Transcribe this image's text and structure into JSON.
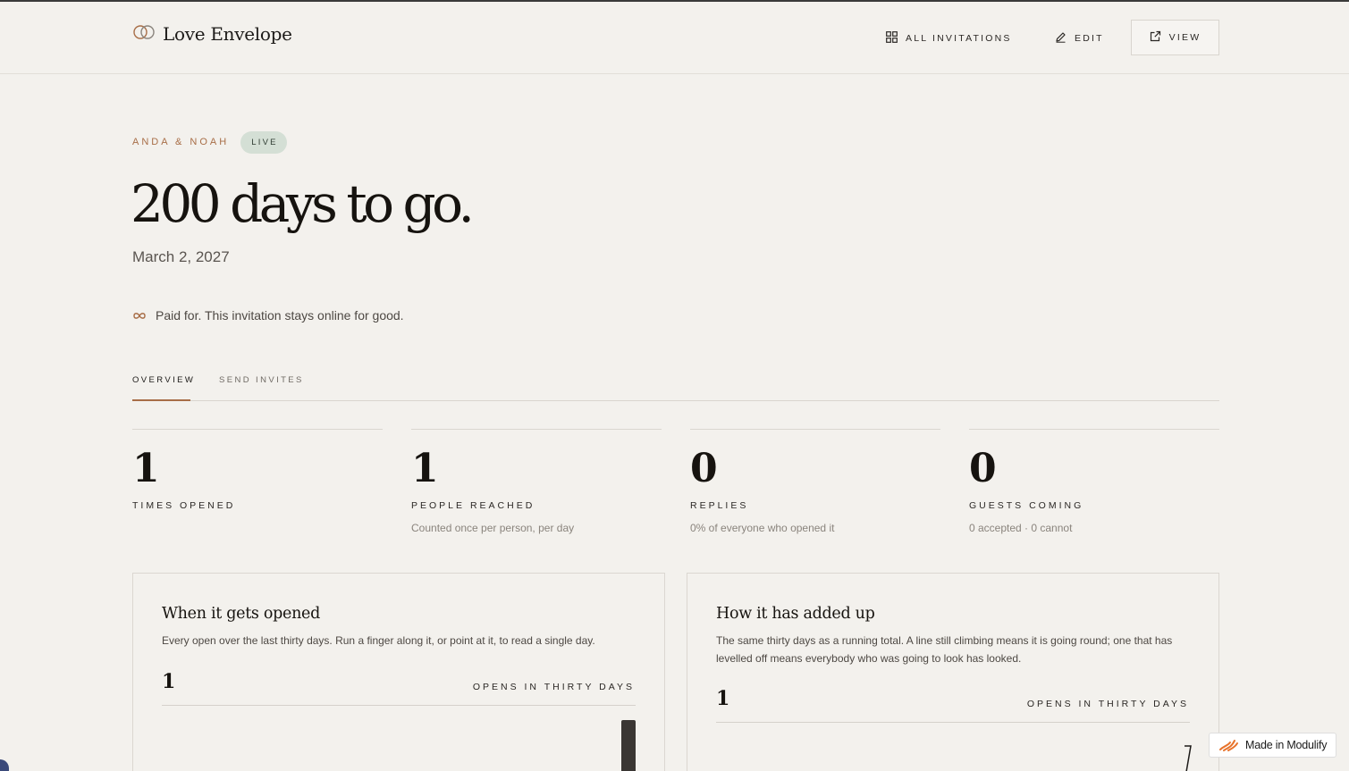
{
  "header": {
    "logo_text": "Love Envelope",
    "nav": {
      "all_invitations": "ALL INVITATIONS",
      "edit": "EDIT",
      "view": "VIEW"
    }
  },
  "hero": {
    "couple": "ANDA & NOAH",
    "status_badge": "LIVE",
    "countdown": "200 days to go.",
    "date": "March 2, 2027",
    "paid_note": "Paid for. This invitation stays online for good."
  },
  "tabs": [
    {
      "label": "OVERVIEW",
      "active": true
    },
    {
      "label": "SEND INVITES",
      "active": false
    }
  ],
  "stats": [
    {
      "value": "1",
      "label": "TIMES OPENED",
      "sub": ""
    },
    {
      "value": "1",
      "label": "PEOPLE REACHED",
      "sub": "Counted once per person, per day"
    },
    {
      "value": "0",
      "label": "REPLIES",
      "sub": "0% of everyone who opened it"
    },
    {
      "value": "0",
      "label": "GUESTS COMING",
      "sub": "0 accepted · 0 cannot"
    }
  ],
  "cards": [
    {
      "title": "When it gets opened",
      "description": "Every open over the last thirty days. Run a finger along it, or point at it, to read a single day.",
      "total": "1",
      "metric_label": "OPENS IN THIRTY DAYS"
    },
    {
      "title": "How it has added up",
      "description": "The same thirty days as a running total. A line still climbing means it is going round; one that has levelled off means everybody who was going to look has looked.",
      "total": "1",
      "metric_label": "OPENS IN THIRTY DAYS"
    }
  ],
  "badge": {
    "made_in": "Made in Modulify"
  },
  "colors": {
    "background": "#f3f1ed",
    "accent": "#a86e47",
    "live_badge": "#d4dfd5",
    "text": "#16130f"
  }
}
